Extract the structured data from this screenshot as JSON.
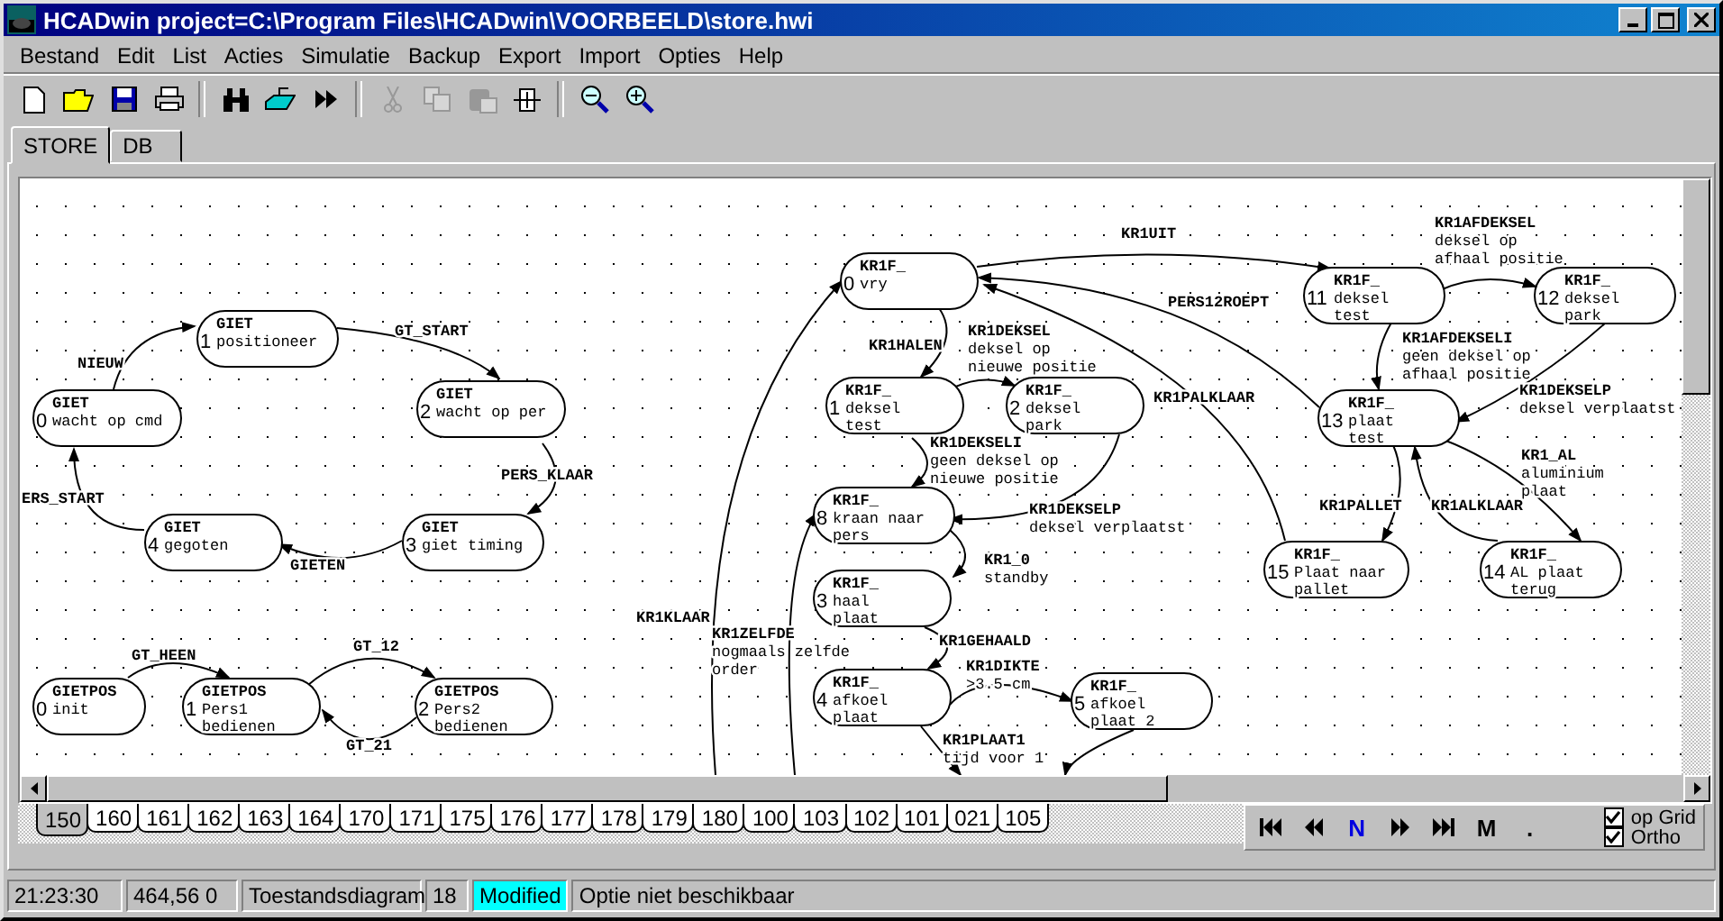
{
  "window": {
    "title": "HCADwin project=C:\\Program Files\\HCADwin\\VOORBEELD\\store.hwi"
  },
  "menu": [
    "Bestand",
    "Edit",
    "List",
    "Acties",
    "Simulatie",
    "Backup",
    "Export",
    "Import",
    "Opties",
    "Help"
  ],
  "toolbar": [
    {
      "kind": "new",
      "disabled": false
    },
    {
      "kind": "open",
      "disabled": false
    },
    {
      "kind": "save",
      "disabled": false
    },
    {
      "kind": "print",
      "disabled": false
    },
    {
      "kind": "separator"
    },
    {
      "kind": "find",
      "disabled": false
    },
    {
      "kind": "export",
      "disabled": false
    },
    {
      "kind": "run",
      "disabled": false
    },
    {
      "kind": "separator"
    },
    {
      "kind": "cut",
      "disabled": true
    },
    {
      "kind": "copy",
      "disabled": true
    },
    {
      "kind": "paste",
      "disabled": true
    },
    {
      "kind": "state",
      "disabled": false
    },
    {
      "kind": "separator"
    },
    {
      "kind": "zoom-out",
      "disabled": false
    },
    {
      "kind": "zoom-in",
      "disabled": false
    }
  ],
  "tabs": [
    {
      "label": "STORE",
      "selected": true
    },
    {
      "label": "DB",
      "selected": false
    }
  ],
  "diagram": {
    "states": [
      {
        "machine": "GIET",
        "number": "1",
        "lines": [
          "positioneer"
        ]
      },
      {
        "machine": "GIET",
        "number": "2",
        "lines": [
          "wacht op per"
        ]
      },
      {
        "machine": "GIET",
        "number": "0",
        "lines": [
          "wacht op cmd"
        ]
      },
      {
        "machine": "GIET",
        "number": "4",
        "lines": [
          "gegoten"
        ]
      },
      {
        "machine": "GIET",
        "number": "3",
        "lines": [
          "giet timing"
        ]
      },
      {
        "machine": "GIETPOS",
        "number": "0",
        "lines": [
          "init"
        ]
      },
      {
        "machine": "GIETPOS",
        "number": "1",
        "lines": [
          "Pers1",
          "bedienen"
        ]
      },
      {
        "machine": "GIETPOS",
        "number": "2",
        "lines": [
          "Pers2",
          "bedienen"
        ]
      },
      {
        "machine": "KR1F_",
        "number": "0",
        "lines": [
          "vry"
        ]
      },
      {
        "machine": "KR1F_",
        "number": "1",
        "lines": [
          "deksel",
          "test"
        ]
      },
      {
        "machine": "KR1F_",
        "number": "2",
        "lines": [
          "deksel",
          "park"
        ]
      },
      {
        "machine": "KR1F_",
        "number": "8",
        "lines": [
          "kraan naar",
          "pers"
        ]
      },
      {
        "machine": "KR1F_",
        "number": "3",
        "lines": [
          "haal",
          "plaat"
        ]
      },
      {
        "machine": "KR1F_",
        "number": "4",
        "lines": [
          "afkoel",
          "plaat"
        ]
      },
      {
        "machine": "KR1F_",
        "number": "5",
        "lines": [
          "afkoel",
          "plaat 2"
        ]
      },
      {
        "machine": "KR1F_",
        "number": "11",
        "lines": [
          "deksel",
          "test"
        ]
      },
      {
        "machine": "KR1F_",
        "number": "12",
        "lines": [
          "deksel",
          "park"
        ]
      },
      {
        "machine": "KR1F_",
        "number": "13",
        "lines": [
          "plaat",
          "test"
        ]
      },
      {
        "machine": "KR1F_",
        "number": "15",
        "lines": [
          "Plaat naar",
          "pallet"
        ]
      },
      {
        "machine": "KR1F_",
        "number": "14",
        "lines": [
          "AL plaat",
          "terug"
        ]
      }
    ],
    "transitions": [
      {
        "event": "NIEUW"
      },
      {
        "event": "GT_START"
      },
      {
        "event": "PERS_KLAAR"
      },
      {
        "event": "ERS_START"
      },
      {
        "event": "GIETEN"
      },
      {
        "event": "GT_HEEN"
      },
      {
        "event": "GT_12"
      },
      {
        "event": "GT_21"
      },
      {
        "event": "KR1UIT"
      },
      {
        "event": "KR1HALEN"
      },
      {
        "event": "KR1DEKSEL",
        "lines": [
          "deksel op",
          "nieuwe positie"
        ]
      },
      {
        "event": "KR1DEKSELI",
        "lines": [
          "geen deksel op",
          "nieuwe positie"
        ]
      },
      {
        "event": "KR1DEKSELP",
        "lines": [
          "deksel verplaatst"
        ]
      },
      {
        "event": "KR1_0",
        "lines": [
          "standby"
        ]
      },
      {
        "event": "KR1KLAAR"
      },
      {
        "event": "KR1ZELFDE",
        "lines": [
          "nogmaals zelfde",
          "order"
        ]
      },
      {
        "event": "KR1GEHAALD"
      },
      {
        "event": "KR1DIKTE",
        "lines": [
          ">3.5 cm"
        ]
      },
      {
        "event": "KR1PLAAT1",
        "lines": [
          "tijd voor 1"
        ]
      },
      {
        "event": "PERS12ROEPT"
      },
      {
        "event": "KR1PALKLAAR"
      },
      {
        "event": "KR1AFDEKSEL",
        "lines": [
          "deksel op",
          "afhaal positie"
        ]
      },
      {
        "event": "KR1AFDEKSELI",
        "lines": [
          "geen deksel op",
          "afhaal positie"
        ]
      },
      {
        "event": "KR1DEKSELP",
        "lines": [
          "deksel verplaatst"
        ]
      },
      {
        "event": "KR1_AL",
        "lines": [
          "aluminium",
          "plaat"
        ]
      },
      {
        "event": "KR1PALLET"
      },
      {
        "event": "KR1ALKLAAR"
      }
    ]
  },
  "page_tabs": [
    {
      "label": "150",
      "selected": true
    },
    {
      "label": "160",
      "selected": false
    },
    {
      "label": "161",
      "selected": false
    },
    {
      "label": "162",
      "selected": false
    },
    {
      "label": "163",
      "selected": false
    },
    {
      "label": "164",
      "selected": false
    },
    {
      "label": "170",
      "selected": false
    },
    {
      "label": "171",
      "selected": false
    },
    {
      "label": "175",
      "selected": false
    },
    {
      "label": "176",
      "selected": false
    },
    {
      "label": "177",
      "selected": false
    },
    {
      "label": "178",
      "selected": false
    },
    {
      "label": "179",
      "selected": false
    },
    {
      "label": "180",
      "selected": false
    },
    {
      "label": "100",
      "selected": false
    },
    {
      "label": "103",
      "selected": false
    },
    {
      "label": "102",
      "selected": false
    },
    {
      "label": "101",
      "selected": false
    },
    {
      "label": "021",
      "selected": false
    },
    {
      "label": "105",
      "selected": false
    }
  ],
  "navigator": [
    {
      "kind": "first"
    },
    {
      "kind": "prev"
    },
    {
      "kind": "label",
      "label": "N",
      "selected": true
    },
    {
      "kind": "next"
    },
    {
      "kind": "last"
    },
    {
      "kind": "label",
      "label": "M",
      "selected": false
    },
    {
      "kind": "label",
      "label": ".",
      "selected": false
    }
  ],
  "options": [
    {
      "label": "op Grid",
      "checked": true
    },
    {
      "label": "Ortho",
      "checked": true
    }
  ],
  "status_bar": [
    {
      "text": "21:23:30",
      "highlighted": false
    },
    {
      "text": "464,56 0",
      "highlighted": false
    },
    {
      "text": "Toestandsdiagram",
      "highlighted": false
    },
    {
      "text": "18",
      "highlighted": false
    },
    {
      "text": "Modified",
      "highlighted": true
    },
    {
      "text": "Optie niet beschikbaar",
      "highlighted": false
    }
  ]
}
